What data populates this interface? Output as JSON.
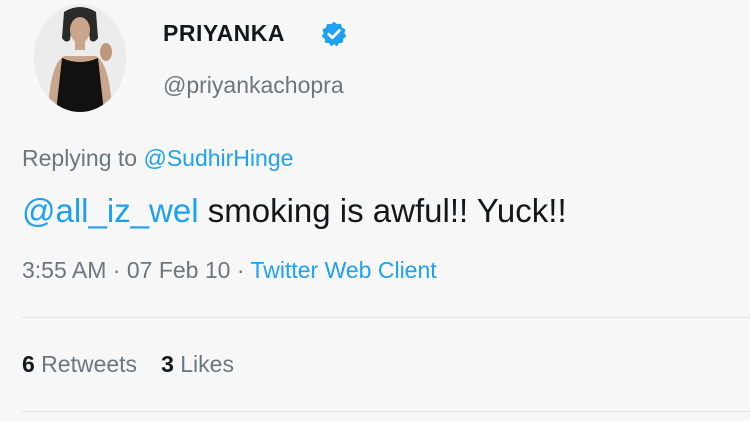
{
  "author": {
    "name": "PRIYANKA",
    "handle": "@priyankachopra",
    "verified": true
  },
  "reply": {
    "prefix": "Replying to ",
    "to": "@SudhirHinge"
  },
  "tweet": {
    "mention": "@all_iz_wel",
    "text": " smoking is awful!! Yuck!!"
  },
  "meta": {
    "time": "3:55 AM",
    "sep1": " · ",
    "date": "07 Feb 10",
    "sep2": " · ",
    "client": "Twitter Web Client"
  },
  "stats": {
    "retweets_count": "6",
    "retweets_label": " Retweets",
    "likes_count": "3",
    "likes_label": " Likes"
  },
  "colors": {
    "link": "#1da1f2",
    "secondary_text": "#6b7680",
    "primary_text": "#14171a",
    "verified_badge": "#1da1f2"
  }
}
